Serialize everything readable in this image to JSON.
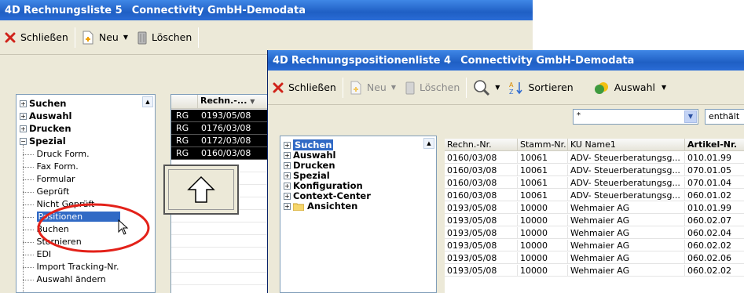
{
  "back_window": {
    "title": "Rechnungsliste 5",
    "subtitle": "Connectivity GmbH-Demodata",
    "toolbar": {
      "close": "Schließen",
      "new": "Neu",
      "delete": "Löschen"
    },
    "tree": {
      "nodes": [
        {
          "sign": "+",
          "label": "Suchen"
        },
        {
          "sign": "+",
          "label": "Auswahl"
        },
        {
          "sign": "+",
          "label": "Drucken"
        },
        {
          "sign": "−",
          "label": "Spezial"
        }
      ],
      "leaves": [
        "Druck Form.",
        "Fax Form.",
        "Formular",
        "Geprüft",
        "Nicht Geprüft",
        "Positionen",
        "Buchen",
        "Stornieren",
        "EDI",
        "Import Tracking-Nr.",
        "Auswahl ändern"
      ],
      "selected": "Positionen"
    },
    "grid": {
      "header": "Rechn.-...",
      "rows": [
        {
          "type": "RG",
          "number": "0193/05/08"
        },
        {
          "type": "RG",
          "number": "0176/03/08"
        },
        {
          "type": "RG",
          "number": "0172/03/08"
        },
        {
          "type": "RG",
          "number": "0160/03/08"
        }
      ]
    }
  },
  "front_window": {
    "title": "Rechnungspositionenliste 4",
    "subtitle": "Connectivity GmbH-Demodata",
    "toolbar": {
      "close": "Schließen",
      "new": "Neu",
      "delete": "Löschen",
      "sort": "Sortieren",
      "select": "Auswahl"
    },
    "filter": {
      "value": "*",
      "operator": "enthält"
    },
    "tree": [
      {
        "sign": "+",
        "label": "Suchen",
        "selected": true
      },
      {
        "sign": "+",
        "label": "Auswahl"
      },
      {
        "sign": "+",
        "label": "Drucken"
      },
      {
        "sign": "+",
        "label": "Spezial"
      },
      {
        "sign": "+",
        "label": "Konfiguration"
      },
      {
        "sign": "+",
        "label": "Context-Center"
      },
      {
        "sign": "+",
        "label": "Ansichten",
        "folder": true
      }
    ],
    "table": {
      "columns": [
        "Rechn.-Nr.",
        "Stamm-Nr.",
        "KU Name1",
        "Artikel-Nr."
      ],
      "rows": [
        [
          "0160/03/08",
          "10061",
          "ADV- Steuerberatungsg...",
          "010.01.99"
        ],
        [
          "0160/03/08",
          "10061",
          "ADV- Steuerberatungsg...",
          "070.01.05"
        ],
        [
          "0160/03/08",
          "10061",
          "ADV- Steuerberatungsg...",
          "070.01.04"
        ],
        [
          "0160/03/08",
          "10061",
          "ADV- Steuerberatungsg...",
          "060.01.02"
        ],
        [
          "0193/05/08",
          "10000",
          "Wehmaier AG",
          "010.01.99"
        ],
        [
          "0193/05/08",
          "10000",
          "Wehmaier AG",
          "060.02.07"
        ],
        [
          "0193/05/08",
          "10000",
          "Wehmaier AG",
          "060.02.04"
        ],
        [
          "0193/05/08",
          "10000",
          "Wehmaier AG",
          "060.02.02"
        ],
        [
          "0193/05/08",
          "10000",
          "Wehmaier AG",
          "060.02.06"
        ],
        [
          "0193/05/08",
          "10000",
          "Wehmaier AG",
          "060.02.02"
        ]
      ]
    }
  }
}
